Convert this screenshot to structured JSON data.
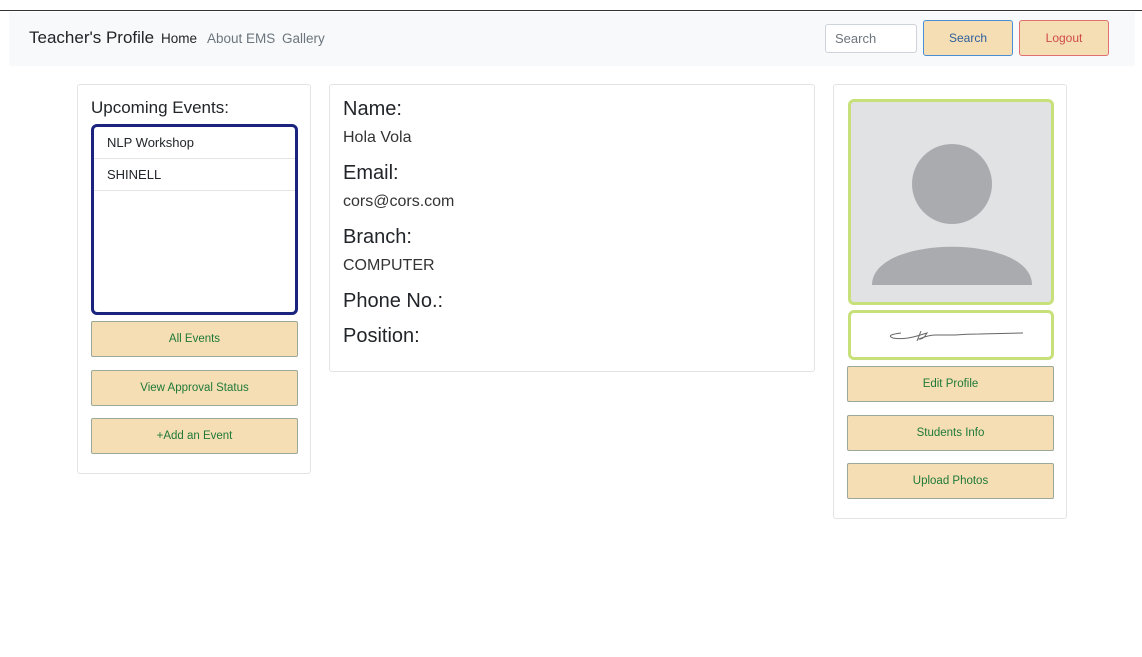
{
  "navbar": {
    "brand": "Teacher's Profile",
    "links": [
      "Home",
      "About EMS",
      "Gallery"
    ],
    "search_placeholder": "Search",
    "search_button": "Search",
    "logout_button": "Logout"
  },
  "events": {
    "title": "Upcoming Events:",
    "items": [
      "NLP Workshop",
      "SHINELL"
    ],
    "buttons": [
      "All Events",
      "View Approval Status",
      "+Add an Event"
    ]
  },
  "profile": {
    "name_label": "Name:",
    "name_value": "Hola Vola",
    "email_label": "Email:",
    "email_value": "cors@cors.com",
    "branch_label": "Branch:",
    "branch_value": "COMPUTER",
    "phone_label": "Phone No.:",
    "position_label": "Position:"
  },
  "sidebar_right": {
    "buttons": [
      "Edit Profile",
      "Students Info",
      "Upload Photos"
    ]
  },
  "colors": {
    "button_bg": "#f5deb3",
    "button_text": "#1f7a3a",
    "photo_border": "#c8e07a",
    "events_border": "#1a237e"
  }
}
